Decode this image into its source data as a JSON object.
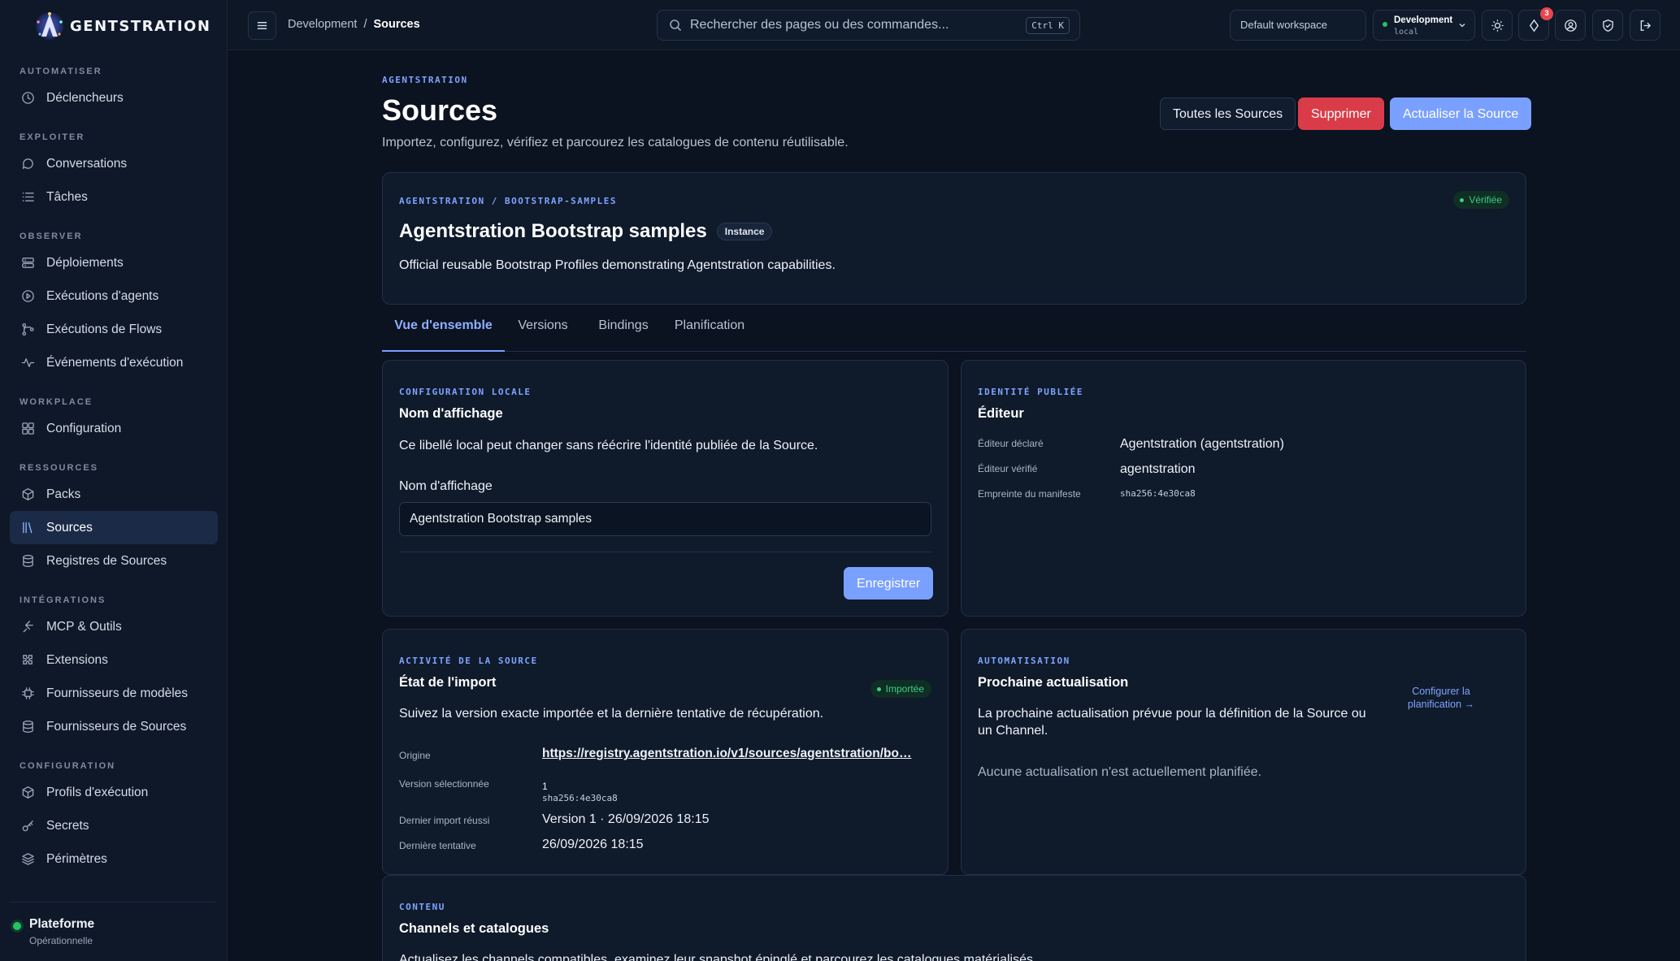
{
  "app": {
    "logo_text": "GENTSTRATION"
  },
  "sidebar": {
    "sections": [
      {
        "title": "AUTOMATISER",
        "items": [
          {
            "label": "Déclencheurs",
            "icon": "clock-icon"
          }
        ]
      },
      {
        "title": "EXPLOITER",
        "items": [
          {
            "label": "Conversations",
            "icon": "chat-icon"
          },
          {
            "label": "Tâches",
            "icon": "list-icon"
          }
        ]
      },
      {
        "title": "OBSERVER",
        "items": [
          {
            "label": "Déploiements",
            "icon": "server-icon"
          },
          {
            "label": "Exécutions d'agents",
            "icon": "play-circle-icon"
          },
          {
            "label": "Exécutions de Flows",
            "icon": "flow-icon"
          },
          {
            "label": "Événements d'exécution",
            "icon": "activity-icon"
          }
        ]
      },
      {
        "title": "WORKPLACE",
        "items": [
          {
            "label": "Configuration",
            "icon": "grid-icon"
          }
        ]
      },
      {
        "title": "RESSOURCES",
        "items": [
          {
            "label": "Packs",
            "icon": "package-icon"
          },
          {
            "label": "Sources",
            "icon": "library-icon",
            "active": true
          },
          {
            "label": "Registres de Sources",
            "icon": "database-icon"
          }
        ]
      },
      {
        "title": "INTÉGRATIONS",
        "items": [
          {
            "label": "MCP & Outils",
            "icon": "plug-icon"
          },
          {
            "label": "Extensions",
            "icon": "puzzle-icon"
          },
          {
            "label": "Fournisseurs de modèles",
            "icon": "cpu-icon"
          },
          {
            "label": "Fournisseurs de Sources",
            "icon": "database-icon"
          }
        ]
      },
      {
        "title": "CONFIGURATION",
        "items": [
          {
            "label": "Profils d'exécution",
            "icon": "package-icon"
          },
          {
            "label": "Secrets",
            "icon": "key-icon"
          },
          {
            "label": "Périmètres",
            "icon": "layers-icon"
          }
        ]
      }
    ],
    "footer": {
      "name": "Plateforme",
      "status": "Opérationnelle",
      "status_color": "#22c55e"
    }
  },
  "topbar": {
    "breadcrumb": {
      "parent": "Development",
      "separator": "/",
      "current": "Sources"
    },
    "search": {
      "placeholder": "Rechercher des pages ou des commandes...",
      "shortcut": "Ctrl K"
    },
    "workspace": "Default workspace",
    "environment": {
      "name": "Development",
      "sub": "local"
    },
    "notifications_count": "3"
  },
  "page": {
    "eyebrow": "AGENTSTRATION",
    "title": "Sources",
    "subtitle": "Importez, configurez, vérifiez et parcourez les catalogues de contenu réutilisable.",
    "actions": {
      "all_sources": "Toutes les Sources",
      "delete": "Supprimer",
      "refresh": "Actualiser la Source"
    }
  },
  "source": {
    "path": "AGENTSTRATION / BOOTSTRAP-SAMPLES",
    "title": "Agentstration Bootstrap samples",
    "kind": "Instance",
    "status": "Vérifiée",
    "description": "Official reusable Bootstrap Profiles demonstrating Agentstration capabilities."
  },
  "tabs": [
    "Vue d'ensemble",
    "Versions",
    "Bindings",
    "Planification"
  ],
  "local_config": {
    "eyebrow": "CONFIGURATION LOCALE",
    "title": "Nom d'affichage",
    "description": "Ce libellé local peut changer sans réécrire l'identité publiée de la Source.",
    "field_label": "Nom d'affichage",
    "field_value": "Agentstration Bootstrap samples",
    "save_label": "Enregistrer"
  },
  "published_identity": {
    "eyebrow": "IDENTITÉ PUBLIÉE",
    "title": "Éditeur",
    "rows": [
      {
        "key": "Éditeur déclaré",
        "value": "Agentstration (agentstration)"
      },
      {
        "key": "Éditeur vérifié",
        "value": "agentstration"
      },
      {
        "key": "Empreinte du manifeste",
        "value": "sha256:4e30ca8"
      }
    ]
  },
  "activity": {
    "eyebrow": "ACTIVITÉ DE LA SOURCE",
    "title": "État de l'import",
    "status": "Importée",
    "description": "Suivez la version exacte importée et la dernière tentative de récupération.",
    "origin_label": "Origine",
    "origin_value": "https://registry.agentstration.io/v1/sources/agentstration/bo…",
    "selected_version_label": "Version sélectionnée",
    "selected_version": "1",
    "selected_version_hash": "sha256:4e30ca8",
    "last_success_label": "Dernier import réussi",
    "last_success_value": "Version 1 · 26/09/2026 18:15",
    "last_attempt_label": "Dernière tentative",
    "last_attempt_value": "26/09/2026 18:15"
  },
  "automation": {
    "eyebrow": "AUTOMATISATION",
    "title": "Prochaine actualisation",
    "description": "La prochaine actualisation prévue pour la définition de la Source ou un Channel.",
    "config_link": "Configurer la planification →",
    "empty": "Aucune actualisation n'est actuellement planifiée."
  },
  "content": {
    "eyebrow": "CONTENU",
    "title": "Channels et catalogues",
    "description": "Actualisez les channels compatibles, examinez leur snapshot épinglé et parcourez les catalogues matérialisés."
  },
  "colors": {
    "accent": "#7aa0ff",
    "danger": "#d93c48",
    "success": "#3ccf86",
    "background": "#0b1220"
  }
}
